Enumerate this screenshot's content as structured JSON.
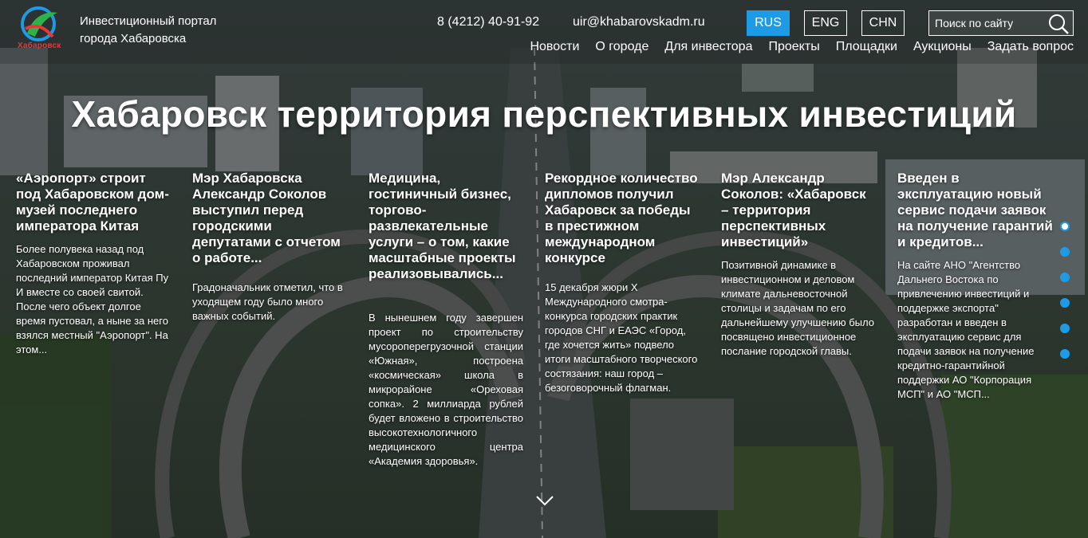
{
  "header": {
    "logo_caption": "Хабаровск",
    "portal_line1": "Инвестиционный портал",
    "portal_line2": "города Хабаровска",
    "phone": "8 (4212) 40-91-92",
    "email": "uir@khabarovskadm.ru",
    "languages": [
      "RUS",
      "ENG",
      "CHN"
    ],
    "active_language": "RUS",
    "search_placeholder": "Поиск по сайту"
  },
  "nav": [
    "Новости",
    "О городе",
    "Для инвестора",
    "Проекты",
    "Площадки",
    "Аукционы",
    "Задать вопрос"
  ],
  "hero": {
    "title": "Хабаровск территория перспективных инвестиций"
  },
  "news": [
    {
      "title": "«Аэропорт» строит под Хабаровском дом-музей последнего императора Китая",
      "text": "Более полувека назад под Хабаровском проживал последний император Китая Пу И вместе со своей свитой. После чего объект долгое время пустовал, а ныне за него взялся местный \"Аэропорт\". На этом..."
    },
    {
      "title": "Мэр Хабаровска Александр Соколов выступил перед городскими депутатами с отчетом о работе...",
      "text": "Градоначальник отметил, что в уходящем году было много важных событий."
    },
    {
      "title": "Медицина, гостиничный бизнес, торгово-развлекательные услуги – о том, какие масштабные проекты реализовывались...",
      "text": "В нынешнем году завершен проект по строительству мусороперегрузочной станции «Южная», построена «космическая» школа в микрорайоне «Ореховая сопка». 2 миллиарда рублей будет вложено в строительство высокотехнологичного медицинского центра «Академия здоровья»."
    },
    {
      "title": "Рекордное количество дипломов получил Хабаровск за победы в престижном международном конкурсе",
      "text": "15 декабря жюри X Международного смотра-конкурса городских практик городов СНГ и ЕАЭС «Город, где хочется жить» подвело итоги масштабного творческого состязания: наш город – безоговорочный флагман."
    },
    {
      "title": "Мэр Александр Соколов: «Хабаровск – территория перспективных инвестиций»",
      "text": "Позитивной динамике в инвестиционном и деловом климате дальневосточной столицы и задачам по его дальнейшему улучшению было посвящено инвестиционное послание городской главы."
    },
    {
      "title": "Введен в эксплуатацию новый сервис подачи заявок на получение гарантий и кредитов...",
      "text": "На сайте АНО \"Агентство Дальнего Востока по привлечению инвестиций и поддержке экспорта\" разработан и введен в эксплуатацию сервис для подачи заявок на получение кредитно-гарантийной поддержки АО \"Корпорация МСП\" и АО \"МСП..."
    }
  ],
  "pager": {
    "count": 6,
    "active": 1
  },
  "colors": {
    "accent": "#1e9be6",
    "text": "#ffffff"
  },
  "icons": [
    "logo-icon",
    "search-icon",
    "chevron-down-icon"
  ]
}
